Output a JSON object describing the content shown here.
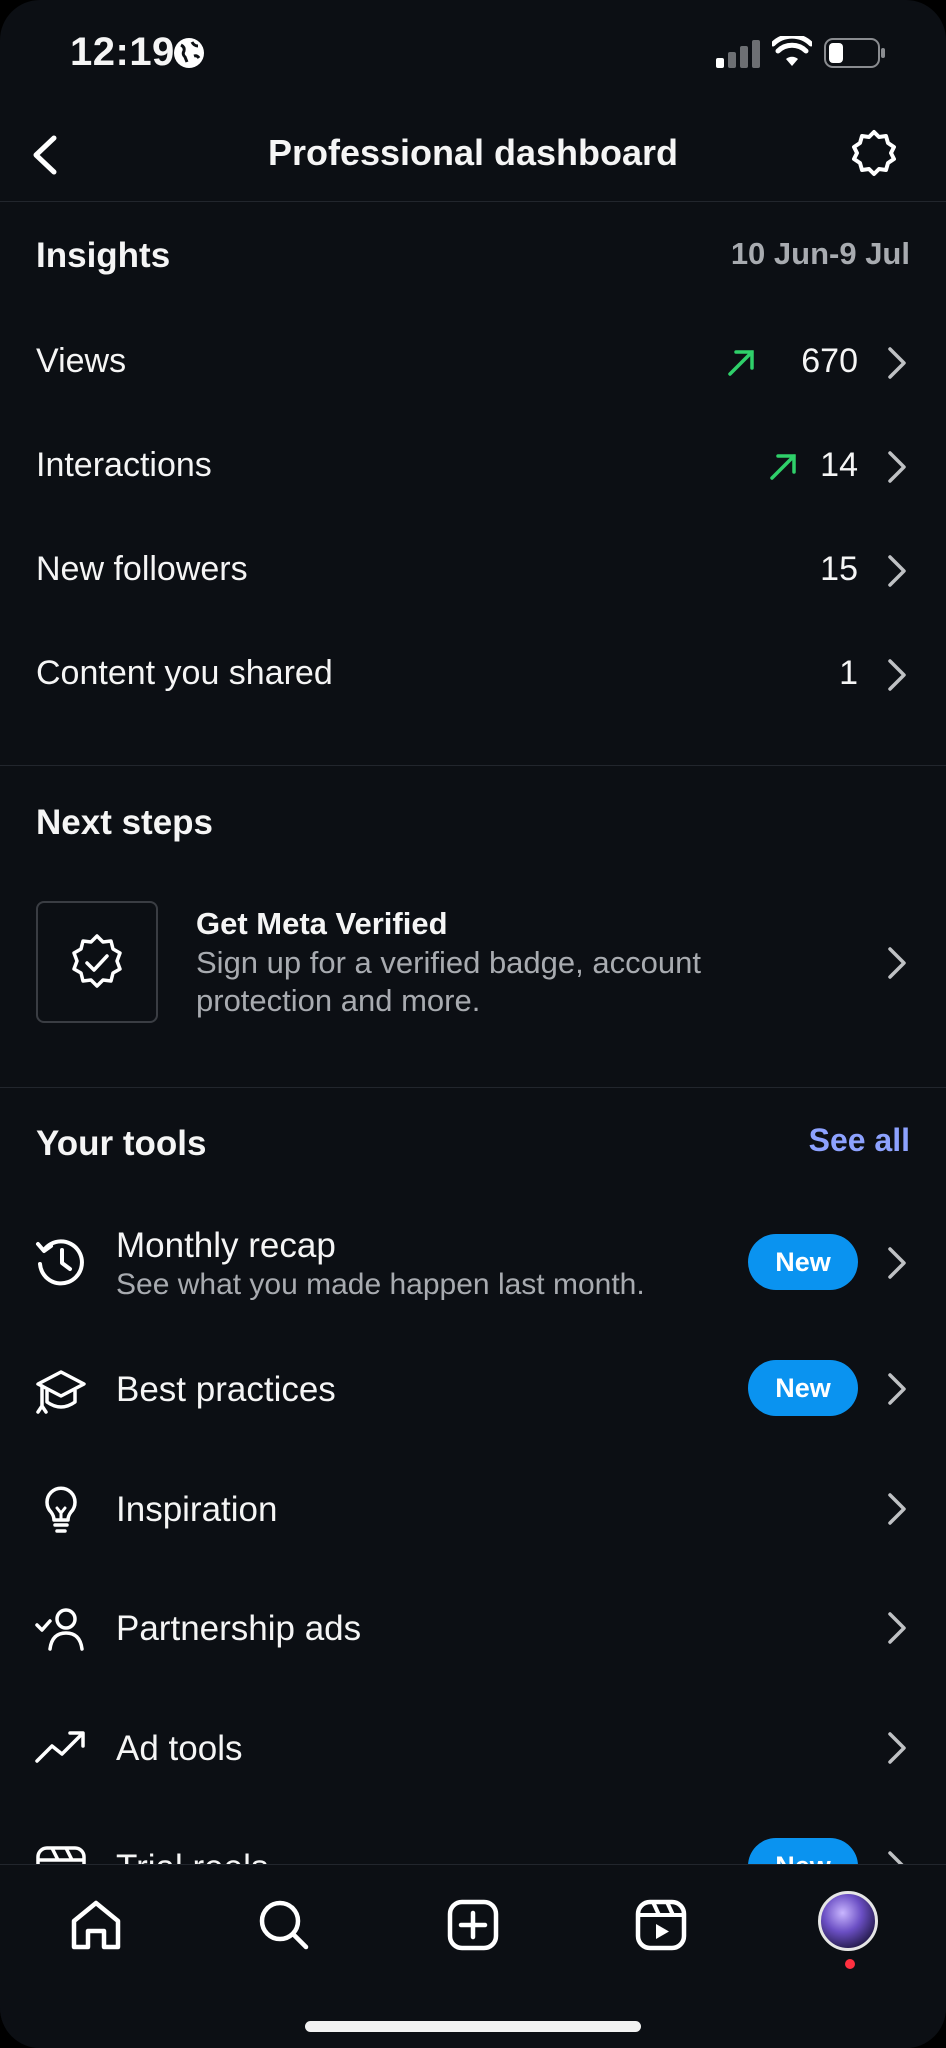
{
  "status_bar": {
    "time": "12:19"
  },
  "header": {
    "title": "Professional dashboard"
  },
  "insights": {
    "title": "Insights",
    "date_range": "10 Jun-9 Jul",
    "rows": [
      {
        "label": "Views",
        "value": "670",
        "trend": "up"
      },
      {
        "label": "Interactions",
        "value": "14",
        "trend": "up"
      },
      {
        "label": "New followers",
        "value": "15"
      },
      {
        "label": "Content you shared",
        "value": "1"
      }
    ]
  },
  "next_steps": {
    "title": "Next steps",
    "item": {
      "title": "Get Meta Verified",
      "subtitle": "Sign up for a verified badge, account protection and more."
    }
  },
  "tools": {
    "title": "Your tools",
    "see_all": "See all",
    "items": [
      {
        "label": "Monthly recap",
        "subtitle": "See what you made happen last month.",
        "badge": "New",
        "icon": "history-icon"
      },
      {
        "label": "Best practices",
        "badge": "New",
        "icon": "graduation-cap-icon"
      },
      {
        "label": "Inspiration",
        "icon": "lightbulb-icon"
      },
      {
        "label": "Partnership ads",
        "icon": "person-check-icon"
      },
      {
        "label": "Ad tools",
        "icon": "trending-up-icon"
      },
      {
        "label": "Trial reels",
        "badge": "New",
        "icon": "trial-reels-icon"
      }
    ]
  },
  "colors": {
    "background": "#0c0f14",
    "accent_link": "#8da2ff",
    "badge": "#0a93f0",
    "trend_up": "#2fd06a"
  }
}
